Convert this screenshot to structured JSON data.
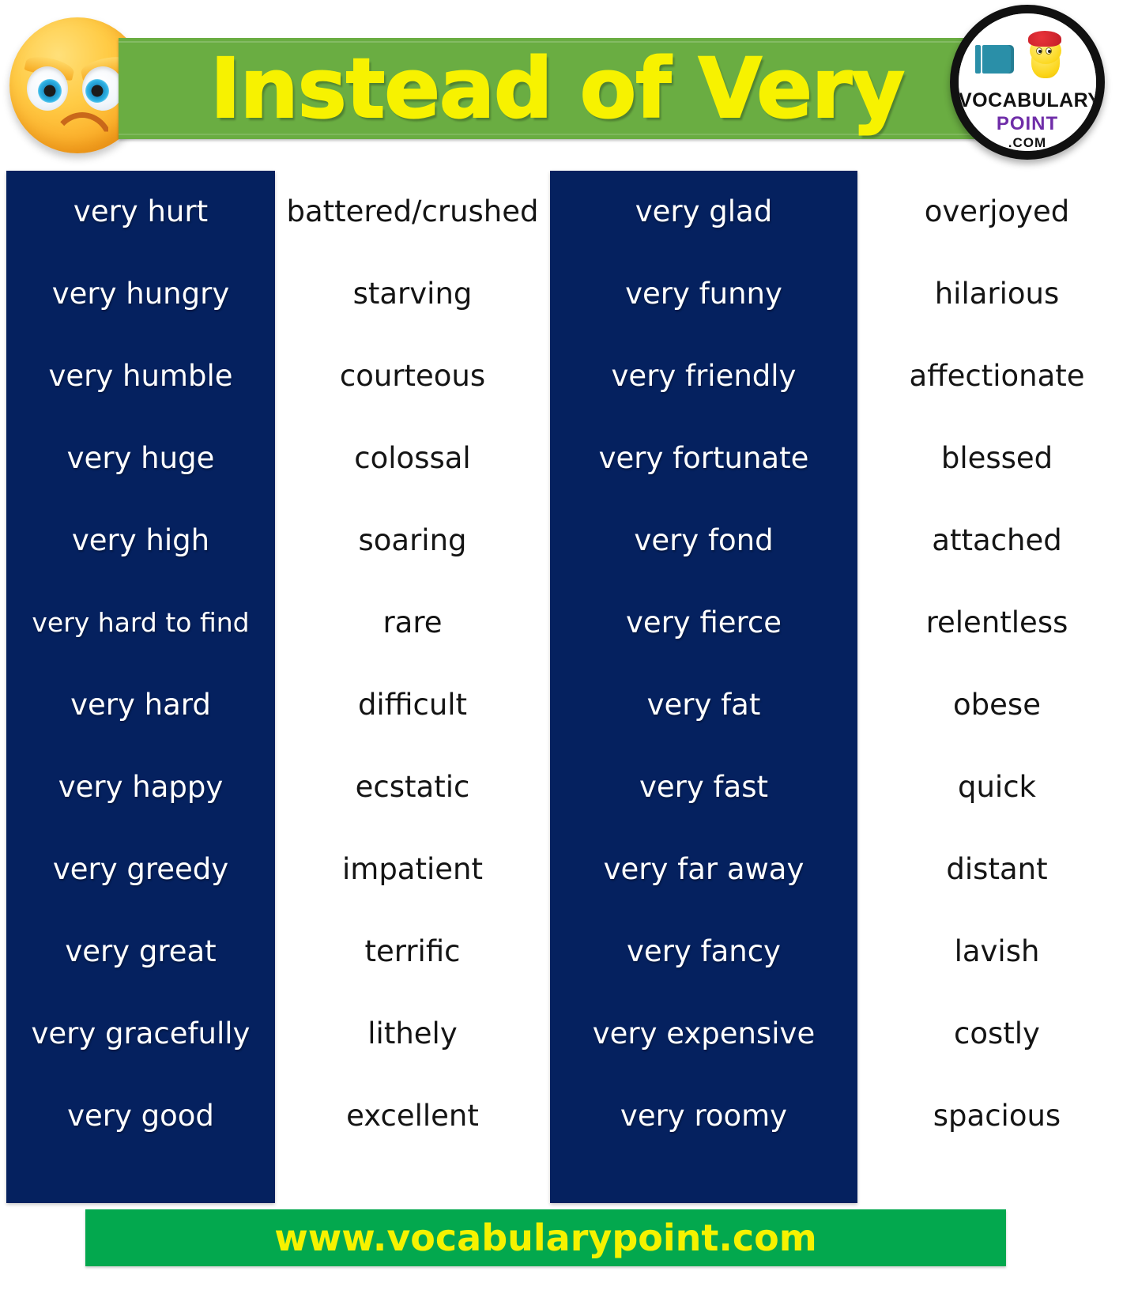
{
  "header": {
    "title": "Instead of Very",
    "emoji_icon": "angry-frowning-face-emoji",
    "logo": {
      "line1": "VOCABULARY",
      "line2": "POINT",
      "line3": ".COM",
      "mascot_icon": "chick-with-cap-icon",
      "book_icon": "book-icon"
    },
    "bar_color": "#6aad42",
    "title_color": "#f7f200"
  },
  "footer": {
    "url": "www.vocabularypoint.com",
    "bar_color": "#03a84e",
    "text_color": "#f6f200"
  },
  "table": {
    "band_color": "#05215f",
    "left_pairs": [
      {
        "very": "very hurt",
        "instead": "battered/crushed"
      },
      {
        "very": "very hungry",
        "instead": "starving"
      },
      {
        "very": "very humble",
        "instead": "courteous"
      },
      {
        "very": "very huge",
        "instead": "colossal"
      },
      {
        "very": "very high",
        "instead": "soaring"
      },
      {
        "very": "very hard to find",
        "instead": "rare"
      },
      {
        "very": "very hard",
        "instead": "difficult"
      },
      {
        "very": "very happy",
        "instead": "ecstatic"
      },
      {
        "very": "very greedy",
        "instead": "impatient"
      },
      {
        "very": "very great",
        "instead": "terrific"
      },
      {
        "very": "very gracefully",
        "instead": "lithely"
      },
      {
        "very": "very good",
        "instead": "excellent"
      }
    ],
    "right_pairs": [
      {
        "very": "very glad",
        "instead": "overjoyed"
      },
      {
        "very": "very funny",
        "instead": "hilarious"
      },
      {
        "very": "very friendly",
        "instead": "affectionate"
      },
      {
        "very": "very fortunate",
        "instead": "blessed"
      },
      {
        "very": "very fond",
        "instead": "attached"
      },
      {
        "very": "very fierce",
        "instead": "relentless"
      },
      {
        "very": "very fat",
        "instead": "obese"
      },
      {
        "very": "very fast",
        "instead": "quick"
      },
      {
        "very": "very far away",
        "instead": "distant"
      },
      {
        "very": "very fancy",
        "instead": "lavish"
      },
      {
        "very": "very expensive",
        "instead": "costly"
      },
      {
        "very": "very roomy",
        "instead": "spacious"
      }
    ]
  }
}
